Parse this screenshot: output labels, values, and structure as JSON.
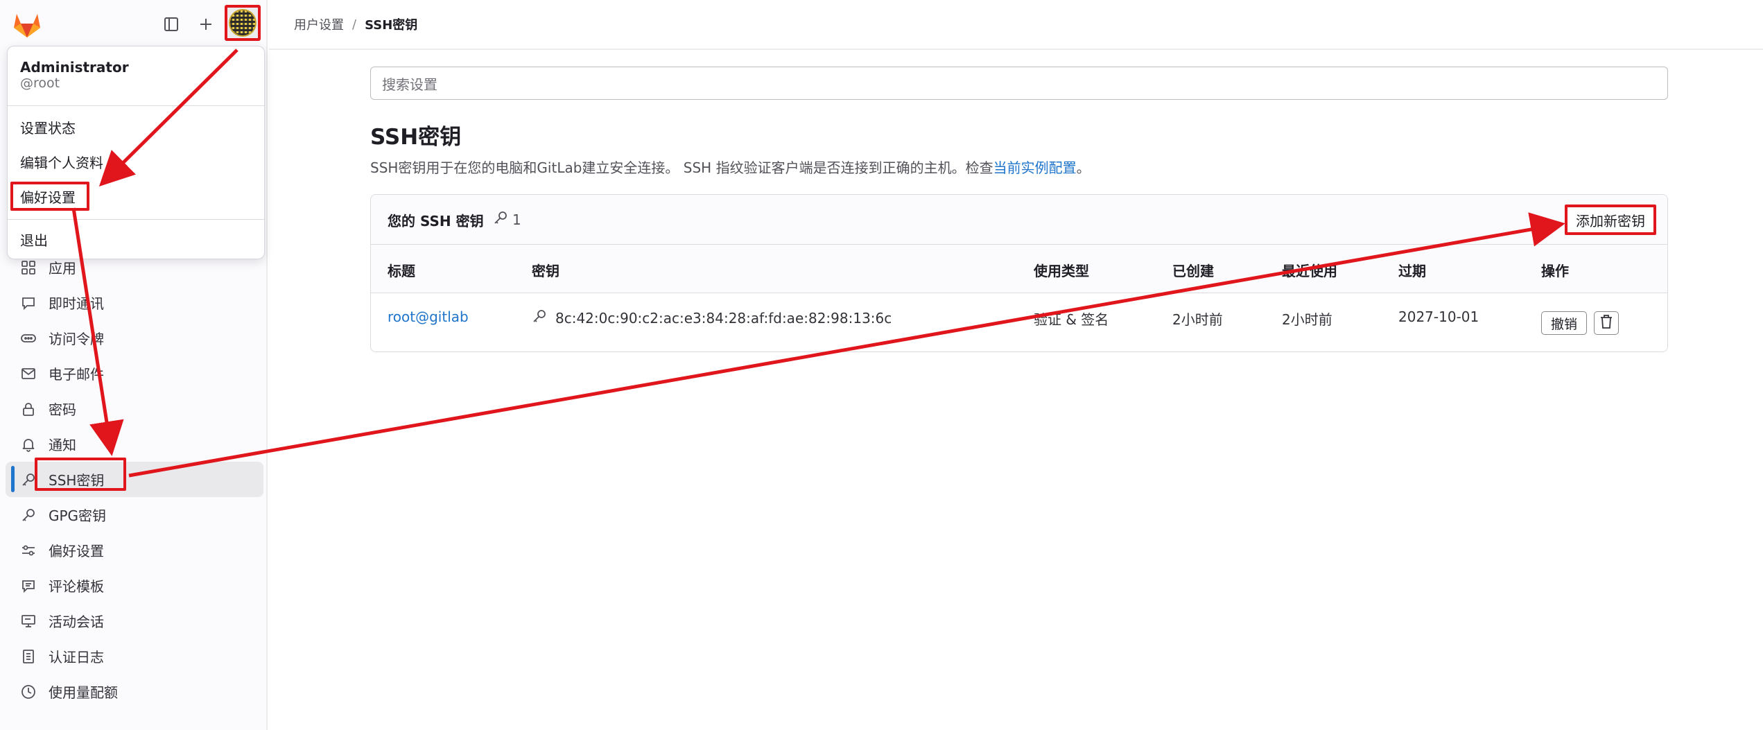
{
  "topbar": {
    "logo_icon": "gitlab-tanuki-icon",
    "sidebar_toggle_icon": "sidebar-toggle-icon",
    "new_icon": "plus-icon",
    "avatar_icon": "user-avatar"
  },
  "user_menu": {
    "name": "Administrator",
    "handle": "@root",
    "items": [
      "设置状态",
      "编辑个人资料",
      "偏好设置",
      "退出"
    ]
  },
  "sidebar": {
    "items": [
      {
        "label": "应用",
        "icon": "applications-icon"
      },
      {
        "label": "即时通讯",
        "icon": "chat-icon"
      },
      {
        "label": "访问令牌",
        "icon": "token-icon"
      },
      {
        "label": "电子邮件",
        "icon": "mail-icon"
      },
      {
        "label": "密码",
        "icon": "lock-icon"
      },
      {
        "label": "通知",
        "icon": "bell-icon"
      },
      {
        "label": "SSH密钥",
        "icon": "key-icon",
        "active": true
      },
      {
        "label": "GPG密钥",
        "icon": "key-icon"
      },
      {
        "label": "偏好设置",
        "icon": "preferences-icon"
      },
      {
        "label": "评论模板",
        "icon": "comment-template-icon"
      },
      {
        "label": "活动会话",
        "icon": "monitor-icon"
      },
      {
        "label": "认证日志",
        "icon": "log-icon"
      },
      {
        "label": "使用量配额",
        "icon": "quota-icon"
      }
    ]
  },
  "breadcrumb": {
    "parent": "用户设置",
    "separator": "/",
    "current": "SSH密钥"
  },
  "search": {
    "placeholder": "搜索设置"
  },
  "page": {
    "title": "SSH密钥",
    "description": "SSH密钥用于在您的电脑和GitLab建立安全连接。 SSH 指纹验证客户端是否连接到正确的主机。检查",
    "description_link": "当前实例配置",
    "description_end": "。"
  },
  "keys_card": {
    "title": "您的 SSH 密钥",
    "count": "1",
    "add_button": "添加新密钥",
    "columns": [
      "标题",
      "密钥",
      "使用类型",
      "已创建",
      "最近使用",
      "过期",
      "操作"
    ],
    "rows": [
      {
        "title": "root@gitlab",
        "fingerprint": "8c:42:0c:90:c2:ac:e3:84:28:af:fd:ae:82:98:13:6c",
        "usage": "验证 & 签名",
        "created": "2小时前",
        "last_used": "2小时前",
        "expires": "2027-10-01",
        "revoke": "撤销"
      }
    ]
  },
  "colors": {
    "annotation": "#e0161c",
    "link": "#1f75cb",
    "active_indicator": "#1f75cb"
  }
}
